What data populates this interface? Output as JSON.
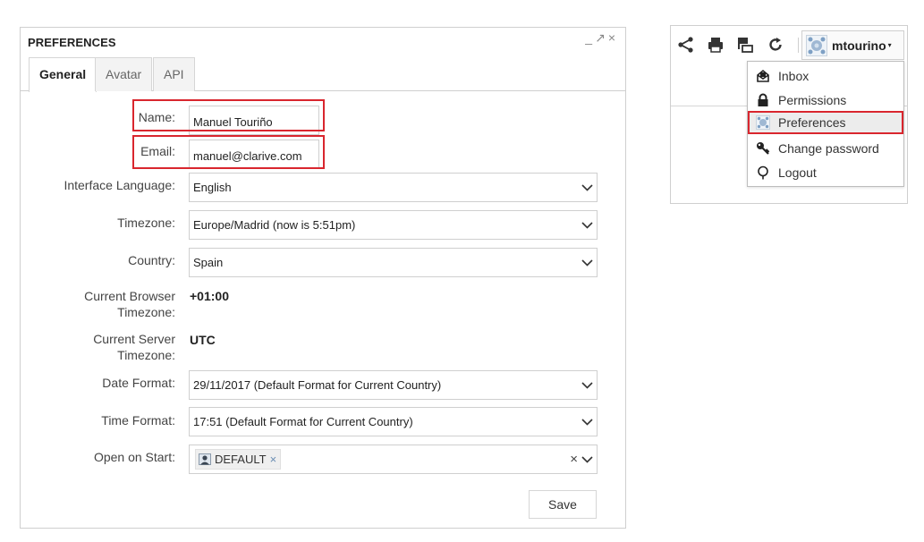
{
  "prefs": {
    "title": "PREFERENCES",
    "window_controls": {
      "minimize": "_",
      "maximize": "↗",
      "close": "×"
    },
    "tabs": [
      {
        "label": "General",
        "active": true
      },
      {
        "label": "Avatar",
        "active": false
      },
      {
        "label": "API",
        "active": false
      }
    ],
    "fields": {
      "name": {
        "label": "Name:",
        "value": "Manuel Touriño"
      },
      "email": {
        "label": "Email:",
        "value": "manuel@clarive.com"
      },
      "language": {
        "label": "Interface Language:",
        "value": "English"
      },
      "timezone": {
        "label": "Timezone:",
        "value": "Europe/Madrid (now is 5:51pm)"
      },
      "country": {
        "label": "Country:",
        "value": "Spain"
      },
      "browser_tz": {
        "label_line1": "Current Browser",
        "label_line2": "Timezone:",
        "value": "+01:00"
      },
      "server_tz": {
        "label_line1": "Current Server",
        "label_line2": "Timezone:",
        "value": "UTC"
      },
      "date_format": {
        "label": "Date Format:",
        "value": "29/11/2017 (Default Format for Current Country)"
      },
      "time_format": {
        "label": "Time Format:",
        "value": "17:51 (Default Format for Current Country)"
      },
      "open_on_start": {
        "label": "Open on Start:",
        "tag": "DEFAULT",
        "tag_remove": "×",
        "clear": "×"
      }
    },
    "save_label": "Save"
  },
  "toolbar": {
    "icons": [
      "share-icon",
      "print-icon",
      "layout-icon",
      "refresh-icon"
    ],
    "user": {
      "name": "mtourino",
      "caret": "▾"
    }
  },
  "user_menu": {
    "items": [
      {
        "label": "Inbox",
        "icon": "inbox-icon"
      },
      {
        "label": "Permissions",
        "icon": "lock-icon"
      },
      {
        "label": "Preferences",
        "icon": "preferences-icon",
        "selected": true
      },
      {
        "label": "Change password",
        "icon": "key-icon"
      },
      {
        "label": "Logout",
        "icon": "power-icon"
      }
    ]
  },
  "colors": {
    "highlight": "#d9262e",
    "border": "#cfcfcf",
    "tag_remove": "#6a8db3"
  }
}
